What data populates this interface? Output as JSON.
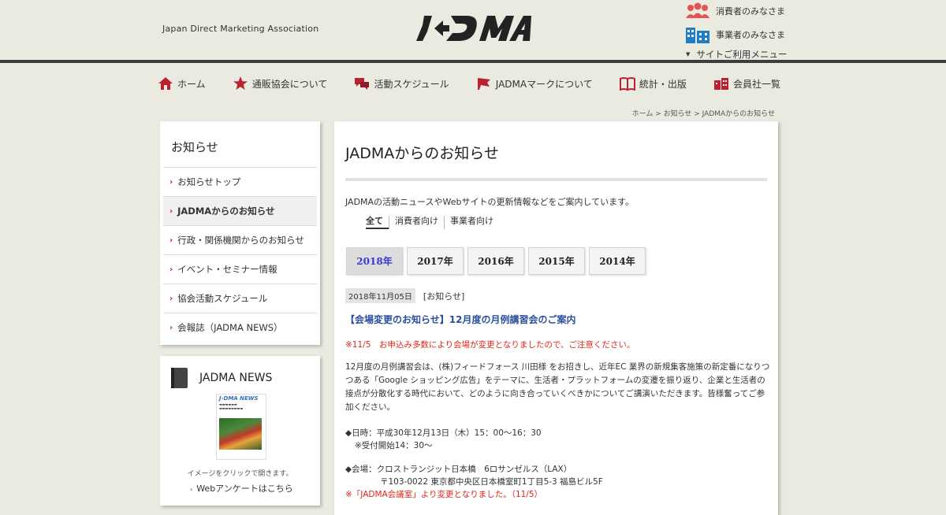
{
  "header": {
    "tagline": "Japan Direct Marketing Association",
    "logo_text": "JADMA",
    "consumer_link": "消費者のみなさま",
    "business_link": "事業者のみなさま",
    "site_menu": "サイトご利用メニュー"
  },
  "nav": {
    "items": [
      {
        "label": "ホーム",
        "icon": "home-icon"
      },
      {
        "label": "通販協会について",
        "icon": "star-icon"
      },
      {
        "label": "活動スケジュール",
        "icon": "chat-icon"
      },
      {
        "label": "JADMAマークについて",
        "icon": "flag-icon"
      },
      {
        "label": "統計・出版",
        "icon": "book-icon"
      },
      {
        "label": "会員社一覧",
        "icon": "building-icon"
      }
    ]
  },
  "breadcrumb": "ホーム > お知らせ > JADMAからのお知らせ",
  "sidebar": {
    "title": "お知らせ",
    "items": [
      {
        "label": "お知らせトップ"
      },
      {
        "label": "JADMAからのお知らせ"
      },
      {
        "label": "行政・関係機関からのお知らせ"
      },
      {
        "label": "イベント・セミナー情報"
      },
      {
        "label": "協会活動スケジュール"
      },
      {
        "label": "会報誌（JADMA NEWS）"
      }
    ],
    "news_title": "JADMA NEWS",
    "news_caption": "イメージをクリックで開きます。",
    "news_link": "Webアンケートはこちら"
  },
  "main": {
    "title": "JADMAからのお知らせ",
    "intro": "JADMAの活動ニュースやWebサイトの更新情報などをご案内しています。",
    "filters": [
      "全て",
      "消費者向け",
      "事業者向け"
    ],
    "years": [
      "2018年",
      "2017年",
      "2016年",
      "2015年",
      "2014年"
    ],
    "post": {
      "date": "2018年11月05日",
      "category": "[お知らせ]",
      "title": "【会場変更のお知らせ】12月度の月例講習会のご案内",
      "notice": "※11/5　お申込み多数により会場が変更となりましたので、ご注意ください。",
      "body": "12月度の月例講習会は、(株)フィードフォース 川田様 をお招きし、近年EC 業界の新規集客施策の新定番になりつつある「Google ショッピング広告」をテーマに、生活者・プラットフォームの変遷を振り返り、企業と生活者の接点が分散化する時代において、どのように向き合っていくべきかについてご講演いただきます。皆様奮ってご参加ください。",
      "datetime": "◆日時：平成30年12月13日（木）15：00～16：30",
      "reception": "※受付開始14：30～",
      "venue": "◆会場：クロストランジット日本橋　6ロサンゼルス（LAX）",
      "address": "〒103-0022 東京都中央区日本橋室町1丁目5-3 福島ビル5F",
      "venue_note": "※「JADMA会議室」より変更となりました。（11/5）"
    }
  }
}
